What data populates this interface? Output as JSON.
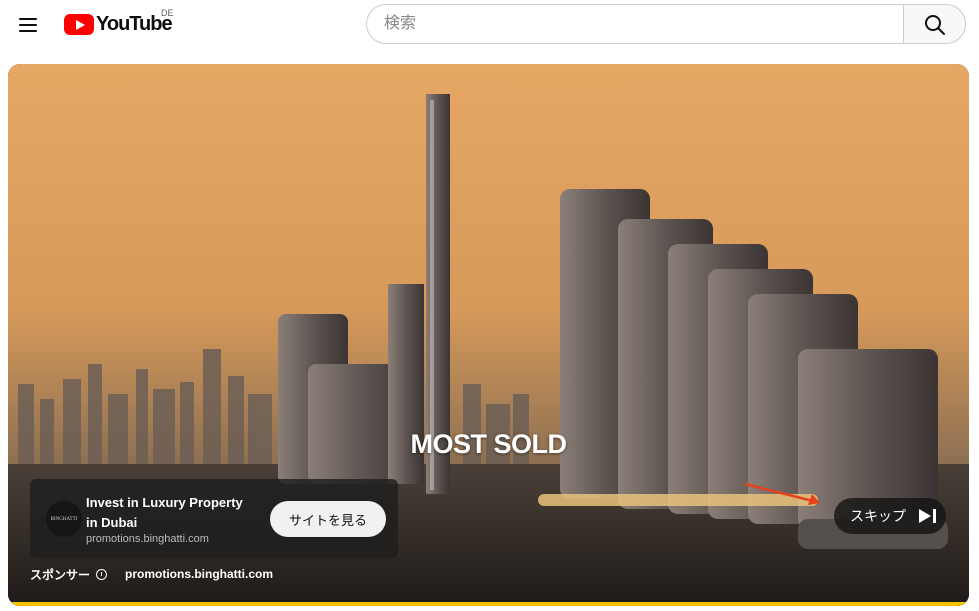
{
  "header": {
    "logo_text": "YouTube",
    "region": "DE",
    "search_placeholder": "検索"
  },
  "player": {
    "caption": "MOST SOLD",
    "ad": {
      "title": "Invest in Luxury Property in Dubai",
      "domain": "promotions.binghatti.com",
      "cta_label": "サイトを見る",
      "thumb_text": "BINGHATTI"
    },
    "sponsor": {
      "label": "スポンサー",
      "link": "promotions.binghatti.com"
    },
    "skip_label": "スキップ",
    "progress": 1.0,
    "colors": {
      "progress": "#f2c500",
      "brand": "#ff0000"
    }
  }
}
